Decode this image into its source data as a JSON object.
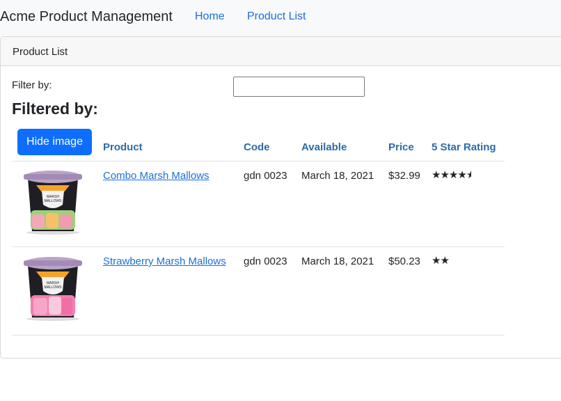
{
  "navbar": {
    "brand": "Acme Product Management",
    "links": [
      "Home",
      "Product List"
    ]
  },
  "card": {
    "header": "Product List"
  },
  "filter": {
    "label": "Filter by:",
    "value": "",
    "filtered_by": "Filtered by:"
  },
  "toggle_button": "Hide image",
  "table": {
    "headers": [
      "Product",
      "Code",
      "Available",
      "Price",
      "5 Star Rating"
    ],
    "rows": [
      {
        "name": "Combo Marsh Mallows",
        "code": "gdn 0023",
        "available": "March 18, 2021",
        "price": "$32.99",
        "rating": 4.5,
        "image": "marshmallow-tub-icon"
      },
      {
        "name": "Strawberry Marsh Mallows",
        "code": "gdn 0023",
        "available": "March 18, 2021",
        "price": "$50.23",
        "rating": 2,
        "image": "marshmallow-tub-icon"
      }
    ]
  },
  "colors": {
    "link": "#1a6fd8",
    "button": "#0d6efd",
    "header_text": "#2e6aa8"
  }
}
